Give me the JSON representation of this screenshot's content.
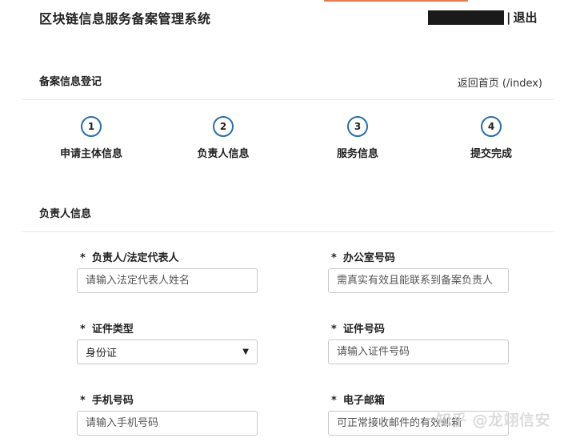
{
  "header": {
    "app_title": "区块链信息服务备案管理系统",
    "separator": "|",
    "logout_label": "退出"
  },
  "page": {
    "section_title": "备案信息登记",
    "back_link": "返回首页 (/index)"
  },
  "steps": [
    {
      "number": "1",
      "label": "申请主体信息"
    },
    {
      "number": "2",
      "label": "负责人信息"
    },
    {
      "number": "3",
      "label": "服务信息"
    },
    {
      "number": "4",
      "label": "提交完成"
    }
  ],
  "form": {
    "section_title": "负责人信息",
    "required_mark": "*",
    "fields": {
      "representative": {
        "label": "负责人/法定代表人",
        "placeholder": "请输入法定代表人姓名"
      },
      "office_phone": {
        "label": "办公室号码",
        "placeholder": "需真实有效且能联系到备案负责人"
      },
      "id_type": {
        "label": "证件类型",
        "value": "身份证",
        "caret": "▼"
      },
      "id_number": {
        "label": "证件号码",
        "placeholder": "请输入证件号码"
      },
      "mobile": {
        "label": "手机号码",
        "placeholder": "请输入手机号码"
      },
      "email": {
        "label": "电子邮箱",
        "placeholder": "可正常接收邮件的有效邮箱"
      }
    }
  },
  "watermark": "知乎 @龙翊信安"
}
